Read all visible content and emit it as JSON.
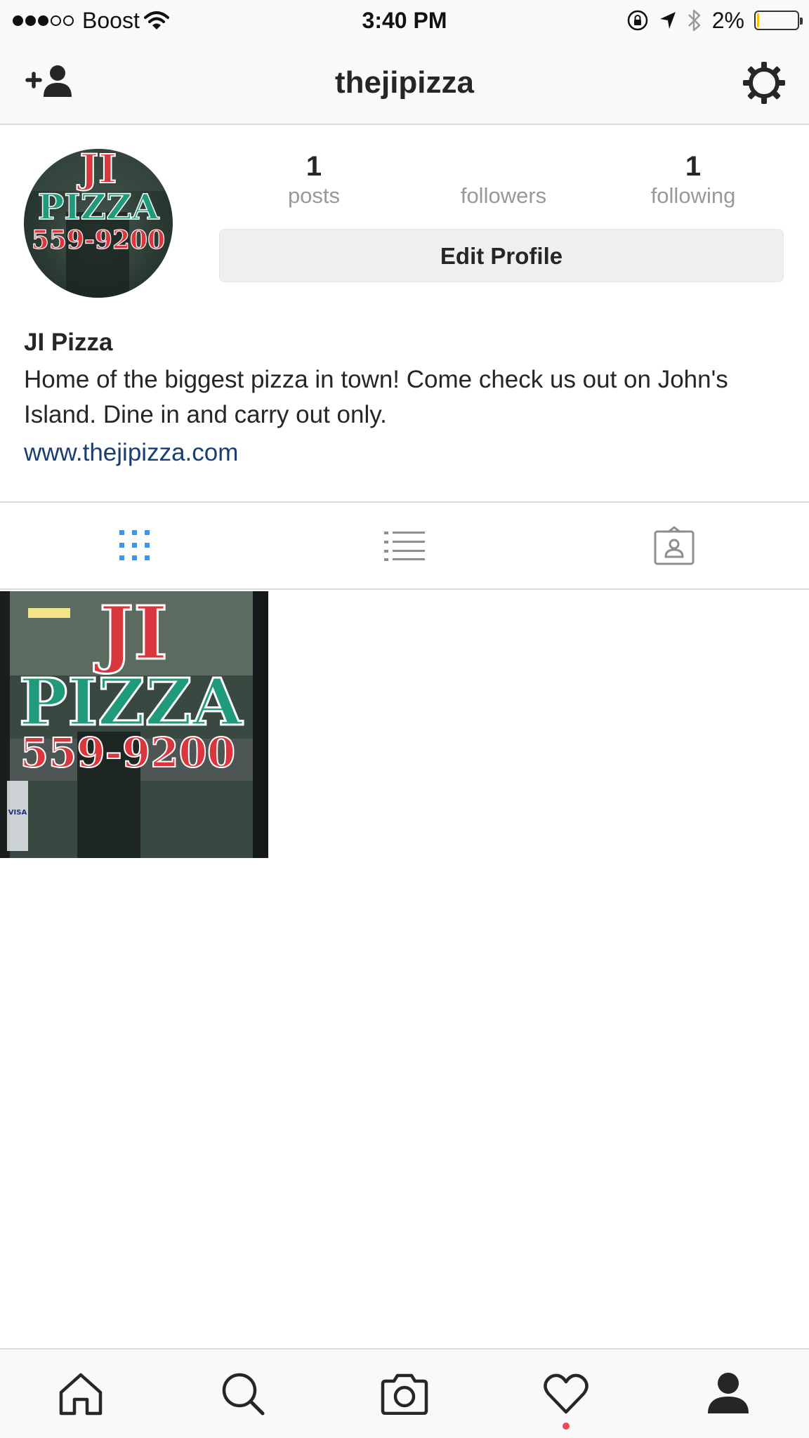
{
  "status_bar": {
    "carrier": "Boost",
    "time": "3:40 PM",
    "battery_percent": "2%",
    "battery_level": 0.02
  },
  "nav": {
    "username": "thejipizza",
    "left_icon": "add-person-icon",
    "right_icon": "gear-icon"
  },
  "profile": {
    "stats": [
      {
        "count": "1",
        "label": "posts"
      },
      {
        "count": "",
        "label": "followers"
      },
      {
        "count": "1",
        "label": "following"
      }
    ],
    "edit_label": "Edit Profile",
    "name": "JI Pizza",
    "bio": "Home of the biggest pizza in town! Come check us out on John's Island. Dine in and carry out only.",
    "website": "www.thejipizza.com",
    "avatar_sign": {
      "line1": "JI",
      "line2": "PIZZA",
      "line3": "559-9200"
    }
  },
  "view_tabs": [
    {
      "name": "grid-view",
      "icon": "grid-icon",
      "active": true
    },
    {
      "name": "list-view",
      "icon": "list-icon",
      "active": false
    },
    {
      "name": "tagged-view",
      "icon": "tagged-photos-icon",
      "active": false
    }
  ],
  "posts": [
    {
      "sign": {
        "line1": "JI",
        "line2": "PIZZA",
        "line3": "559-9200"
      },
      "cards": "VISA"
    }
  ],
  "bottom_tabs": [
    {
      "name": "home",
      "icon": "home-icon"
    },
    {
      "name": "search",
      "icon": "search-icon"
    },
    {
      "name": "camera",
      "icon": "camera-icon"
    },
    {
      "name": "activity",
      "icon": "heart-icon",
      "notification": true
    },
    {
      "name": "profile",
      "icon": "profile-icon",
      "active": true
    }
  ],
  "colors": {
    "accent": "#3897f0",
    "link": "#1a3e74",
    "sign_red": "#d9363e",
    "sign_green": "#1f9a7a",
    "notification": "#ed4956"
  }
}
